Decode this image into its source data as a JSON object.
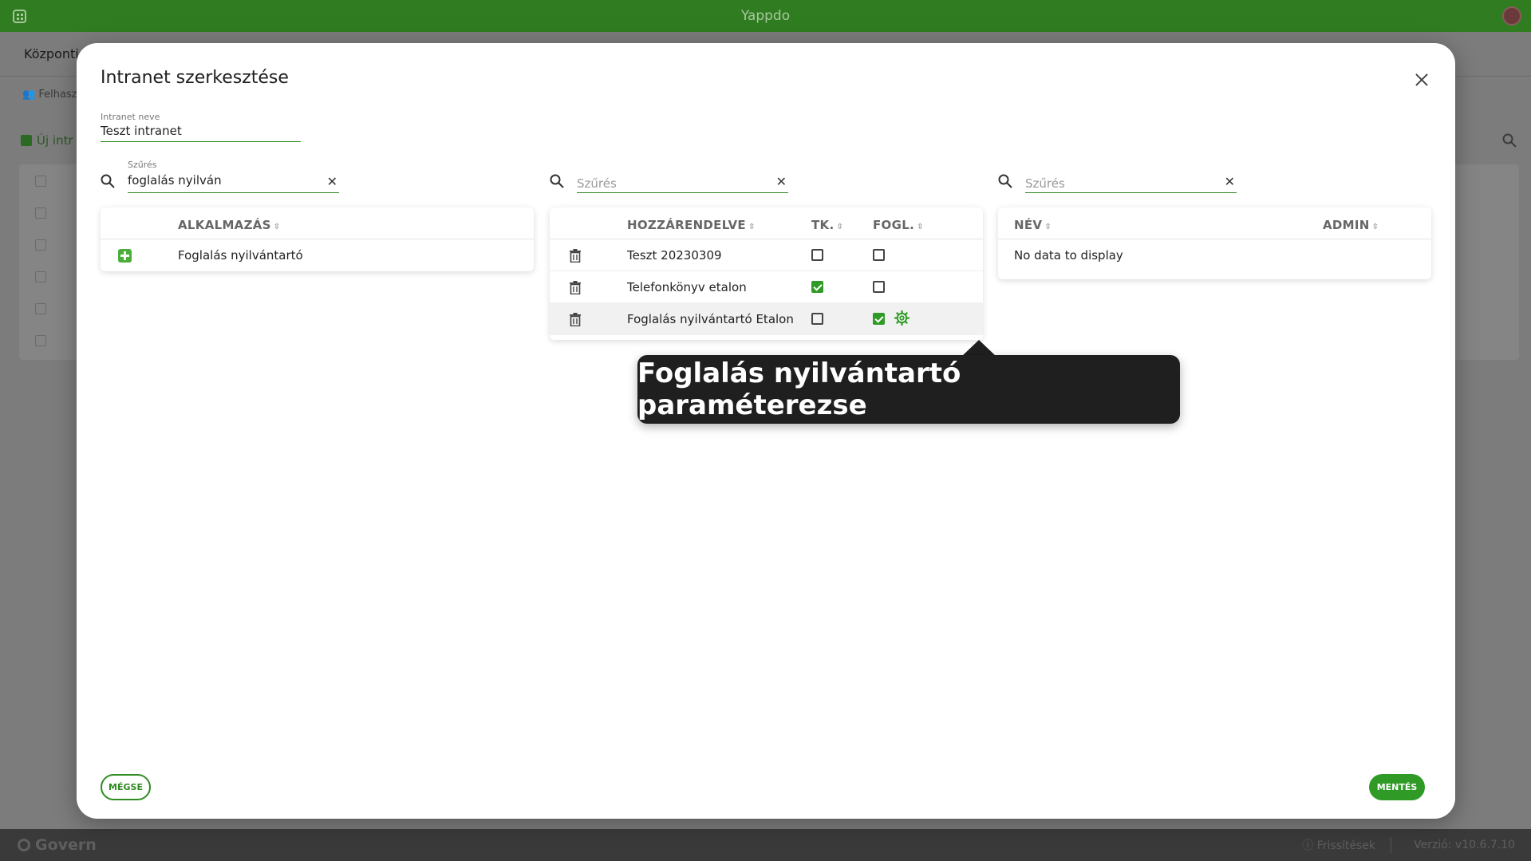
{
  "topbar": {
    "title": "Yappdo"
  },
  "background": {
    "header": "Központi",
    "tab": "Felhasz",
    "new_button": "Új intr"
  },
  "footer": {
    "brand": "Govern",
    "updates": "Frissítések",
    "version": "Verzió: v10.6.7.10"
  },
  "modal": {
    "title": "Intranet szerkesztése",
    "name_label": "Intranet neve",
    "name_value": "Teszt intranet",
    "filters": [
      {
        "label": "Szűrés",
        "value": "foglalás nyilván",
        "placeholder": ""
      },
      {
        "label": "",
        "value": "",
        "placeholder": "Szűrés"
      },
      {
        "label": "",
        "value": "",
        "placeholder": "Szűrés"
      }
    ],
    "apps_table": {
      "header": "ALKALMAZÁS",
      "rows": [
        {
          "name": "Foglalás nyilvántartó"
        }
      ]
    },
    "assigned_table": {
      "headers": {
        "assigned": "HOZZÁRENDELVE",
        "tk": "TK.",
        "fogl": "FOGL."
      },
      "rows": [
        {
          "name": "Teszt 20230309",
          "tk": false,
          "fogl": false
        },
        {
          "name": "Telefonkönyv etalon",
          "tk": true,
          "fogl": false
        },
        {
          "name": "Foglalás nyilvántartó Etalon",
          "tk": false,
          "fogl": true
        }
      ]
    },
    "users_table": {
      "headers": {
        "name": "NÉV",
        "admin": "ADMIN"
      },
      "empty": "No data to display"
    },
    "tooltip": "Foglalás nyilvántartó paraméterezse",
    "cancel_label": "MÉGSE",
    "save_label": "MENTÉS"
  },
  "colors": {
    "brand_green": "#2f7d20",
    "accent_green": "#2f9a25"
  }
}
